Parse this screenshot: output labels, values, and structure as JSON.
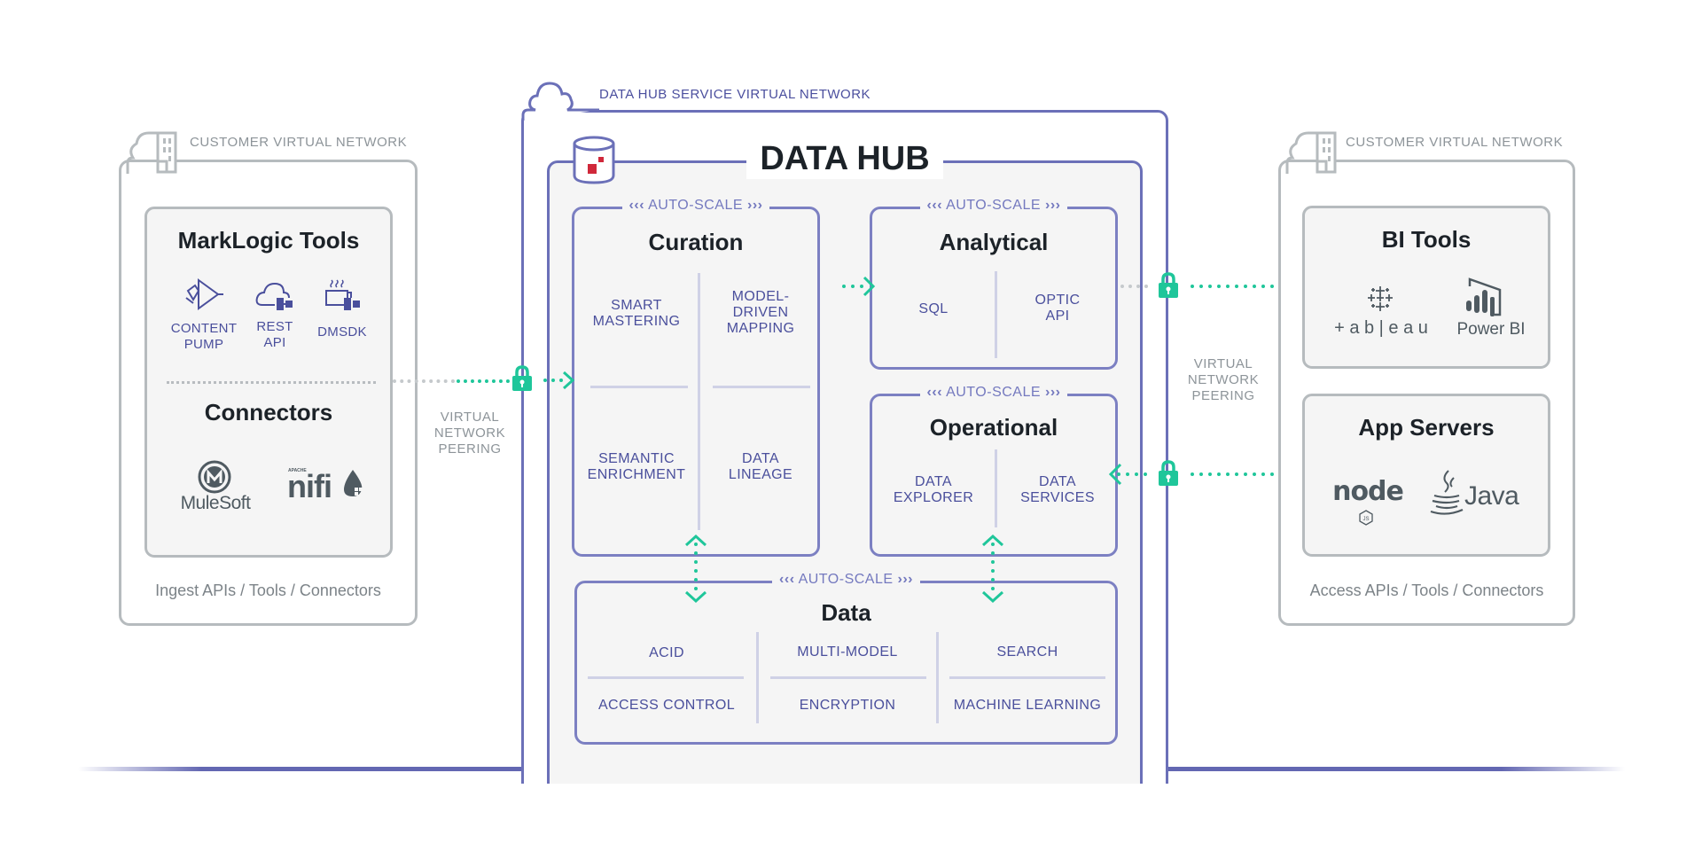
{
  "left_network": {
    "label": "CUSTOMER VIRTUAL NETWORK",
    "caption": "Ingest APIs / Tools / Connectors",
    "marklogic_tools": {
      "title": "MarkLogic Tools",
      "items": [
        {
          "icon": "content-pump-icon",
          "label_line1": "CONTENT",
          "label_line2": "PUMP"
        },
        {
          "icon": "rest-api-icon",
          "label_line1": "REST",
          "label_line2": "API"
        },
        {
          "icon": "dmsdk-icon",
          "label_line1": "DMSDK",
          "label_line2": ""
        }
      ]
    },
    "connectors": {
      "title": "Connectors",
      "logos": [
        {
          "icon": "mulesoft-logo",
          "text": "MuleSoft"
        },
        {
          "icon": "nifi-logo",
          "text": "nifi",
          "super": "APACHE"
        }
      ]
    }
  },
  "left_peering": {
    "line1": "VIRTUAL",
    "line2": "NETWORK",
    "line3": "PEERING"
  },
  "right_peering": {
    "line1": "VIRTUAL",
    "line2": "NETWORK",
    "line3": "PEERING"
  },
  "service_network": {
    "label": "DATA HUB SERVICE VIRTUAL NETWORK",
    "data_hub": {
      "title": "DATA HUB",
      "autoscale_label": "AUTO-SCALE",
      "autoscale_left": "‹‹‹",
      "autoscale_right": "›››",
      "curation": {
        "title": "Curation",
        "features": [
          {
            "line1": "SMART",
            "line2": "MASTERING",
            "line3": ""
          },
          {
            "line1": "MODEL-",
            "line2": "DRIVEN",
            "line3": "MAPPING"
          },
          {
            "line1": "SEMANTIC",
            "line2": "ENRICHMENT",
            "line3": ""
          },
          {
            "line1": "DATA",
            "line2": "LINEAGE",
            "line3": ""
          }
        ]
      },
      "analytical": {
        "title": "Analytical",
        "features": [
          {
            "line1": "SQL",
            "line2": ""
          },
          {
            "line1": "OPTIC",
            "line2": "API"
          }
        ]
      },
      "operational": {
        "title": "Operational",
        "features": [
          {
            "line1": "DATA",
            "line2": "EXPLORER"
          },
          {
            "line1": "DATA",
            "line2": "SERVICES"
          }
        ]
      },
      "data": {
        "title": "Data",
        "features": [
          "ACID",
          "MULTI-MODEL",
          "SEARCH",
          "ACCESS CONTROL",
          "ENCRYPTION",
          "MACHINE LEARNING"
        ]
      }
    }
  },
  "right_network": {
    "label": "CUSTOMER VIRTUAL NETWORK",
    "caption": "Access APIs / Tools / Connectors",
    "bi_tools": {
      "title": "BI Tools",
      "logos": [
        {
          "icon": "tableau-logo",
          "text": "+ a b | e a u"
        },
        {
          "icon": "power-bi-logo",
          "text": "Power BI"
        }
      ]
    },
    "app_servers": {
      "title": "App Servers",
      "logos": [
        {
          "icon": "nodejs-logo",
          "text": "node"
        },
        {
          "icon": "java-logo",
          "text": "Java"
        }
      ]
    }
  },
  "colors": {
    "accent_green": "#1fc69a",
    "hub_blue": "#6b70b8",
    "text_blue": "#4a4f9c",
    "border_gray": "#b6bbbe",
    "marklogic_red": "#d0283a"
  }
}
